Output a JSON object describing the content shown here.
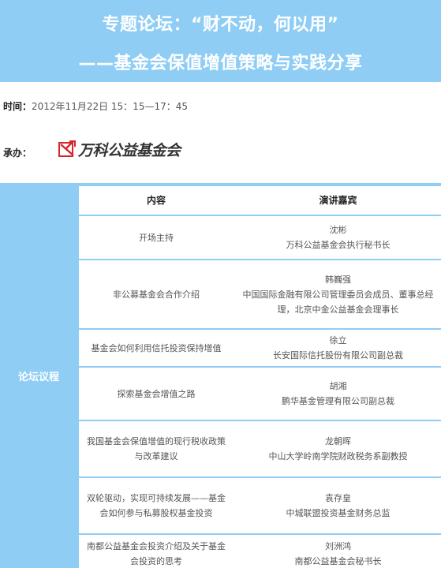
{
  "banner": {
    "line1": "专题论坛：“财不动，何以用”",
    "line2": "——基金会保值增值策略与实践分享"
  },
  "info": {
    "time_label": "时间：",
    "time_value": "2012年11月22日  15：15—17：45",
    "host_label": "承办：",
    "host_logo_text": "万科公益基金会"
  },
  "agenda": {
    "side_label": "论坛议程",
    "headers": {
      "content": "内容",
      "speaker": "演讲嘉宾"
    },
    "rows": [
      {
        "content": "开场主持",
        "name": "沈彬",
        "role": "万科公益基金会执行秘书长"
      },
      {
        "content": "非公募基金会合作介绍",
        "name": "韩巍强",
        "role": "中国国际金融有限公司管理委员会成员、董事总经理，北京中金公益基金会理事长"
      },
      {
        "content": "基金会如何利用信托投资保持增值",
        "name": "徐立",
        "role": "长安国际信托股份有限公司副总裁"
      },
      {
        "content": "探索基金会增值之路",
        "name": "胡湘",
        "role": "鹏华基金管理有限公司副总裁"
      },
      {
        "content": "我国基金会保值增值的现行税收政策与改革建议",
        "name": "龙朝晖",
        "role": "中山大学岭南学院财政税务系副教授"
      },
      {
        "content": "双轮驱动，实现可持续发展——基金会如何参与私募股权基金投资",
        "name": "袁存皇",
        "role": "中城联盟投资基金财务总监"
      },
      {
        "content": "南都公益基金会投资介绍及关于基金会投资的思考",
        "name": "刘洲鸿",
        "role": "南都公益基金会秘书长"
      }
    ]
  }
}
